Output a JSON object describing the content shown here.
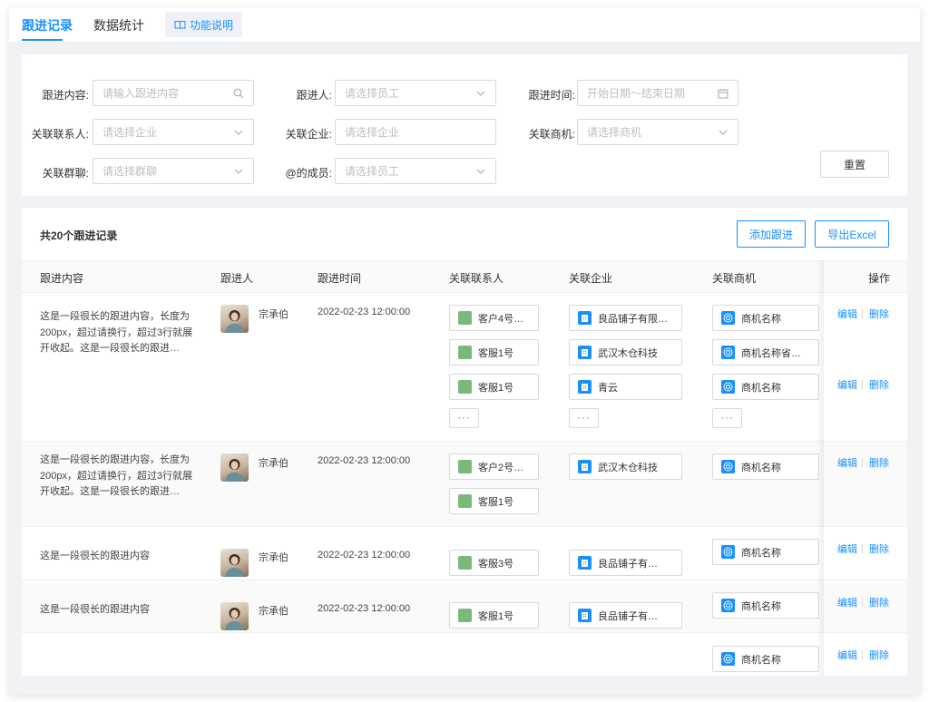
{
  "tabs": [
    {
      "label": "跟进记录",
      "active": true
    },
    {
      "label": "数据统计",
      "active": false
    }
  ],
  "help_tab": {
    "label": "功能说明",
    "icon": "book-icon"
  },
  "filters": {
    "content": {
      "label": "跟进内容:",
      "placeholder": "请输入跟进内容"
    },
    "follower": {
      "label": "跟进人:",
      "placeholder": "请选择员工"
    },
    "time": {
      "label": "跟进时间:",
      "placeholder": "开始日期～结束日期"
    },
    "contact": {
      "label": "关联联系人:",
      "placeholder": "请选择企业"
    },
    "company": {
      "label": "关联企业:",
      "placeholder": "请选择企业"
    },
    "deal": {
      "label": "关联商机:",
      "placeholder": "请选择商机"
    },
    "group": {
      "label": "关联群聊:",
      "placeholder": "请选择群聊"
    },
    "mention": {
      "label": "@的成员:",
      "placeholder": "请选择员工"
    },
    "reset_label": "重置"
  },
  "table": {
    "count_title": "共20个跟进记录",
    "add_label": "添加跟进",
    "export_label": "导出Excel",
    "columns": [
      "跟进内容",
      "跟进人",
      "跟进时间",
      "关联联系人",
      "关联企业",
      "关联商机",
      "操作"
    ],
    "rows": [
      {
        "content": "这是一段很长的跟进内容，长度为200px，超过请换行，超过3行就展开收起。这是一段很长的跟进…",
        "person": "宗承伯",
        "time": "2022-02-23 12:00:00",
        "contacts": [
          "客户4号…",
          "客服1号",
          "客服1号"
        ],
        "companies": [
          "良品铺子有限…",
          "武汉木仓科技",
          "青云"
        ],
        "deals": [
          "商机名称",
          "商机名称省…",
          "商机名称"
        ],
        "more": "···",
        "ops": [
          [
            "编辑",
            "删除"
          ],
          [
            "编辑",
            "删除"
          ]
        ]
      },
      {
        "content": "这是一段很长的跟进内容，长度为200px，超过请换行，超过3行就展开收起。这是一段很长的跟进…",
        "person": "宗承伯",
        "time": "2022-02-23 12:00:00",
        "contacts": [
          "客户2号…",
          "客服1号"
        ],
        "companies": [
          "武汉木仓科技"
        ],
        "deals": [
          "商机名称"
        ],
        "ops": [
          [
            "编辑",
            "删除"
          ]
        ]
      },
      {
        "content": "这是一段很长的跟进内容",
        "person": "宗承伯",
        "time": "2022-02-23 12:00:00",
        "contacts": [
          "客服3号"
        ],
        "companies": [
          "良品铺子有…"
        ],
        "deals": [
          "商机名称"
        ],
        "ops": [
          [
            "编辑",
            "删除"
          ]
        ]
      },
      {
        "content": "这是一段很长的跟进内容",
        "person": "宗承伯",
        "time": "2022-02-23 12:00:00",
        "contacts": [
          "客服1号"
        ],
        "companies": [
          "良品铺子有…"
        ],
        "deals": [
          "商机名称"
        ],
        "ops": [
          [
            "编辑",
            "删除"
          ]
        ]
      },
      {
        "deals": [
          "商机名称"
        ],
        "ops": [
          [
            "编辑",
            "删除"
          ]
        ]
      }
    ]
  },
  "colors": {
    "accent": "#1890ff",
    "contact_icon": "#7ab97a"
  }
}
